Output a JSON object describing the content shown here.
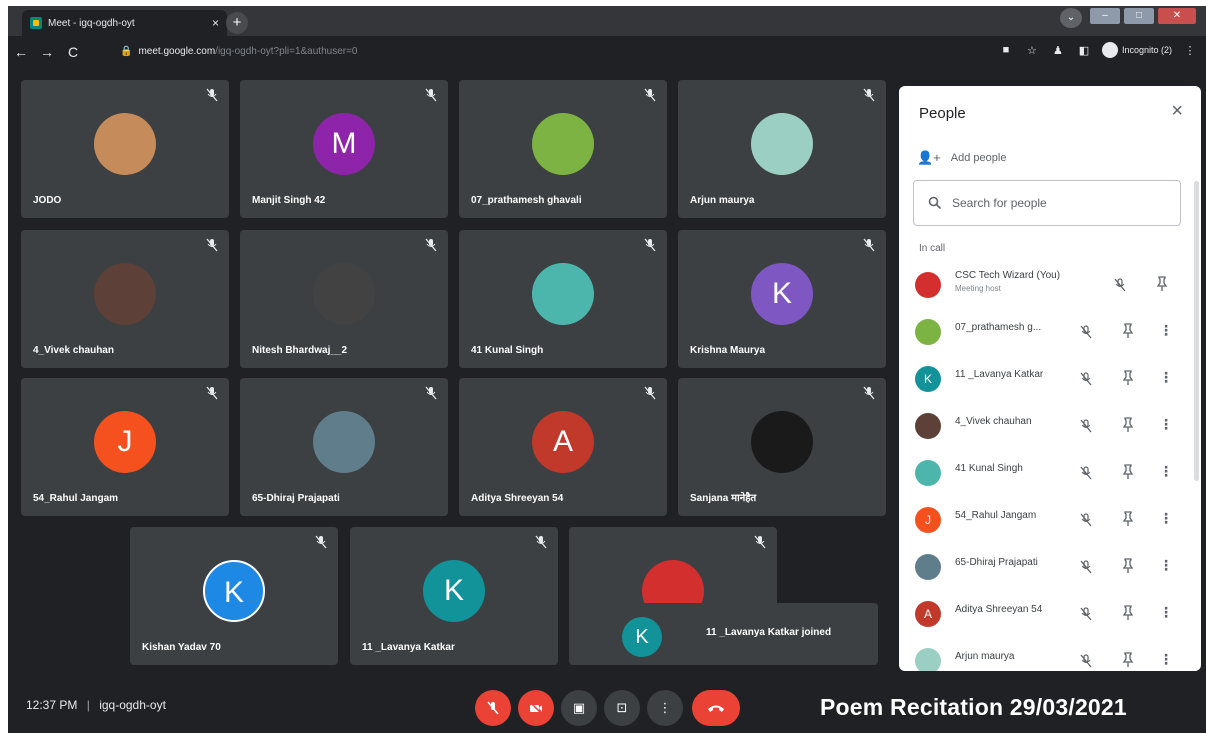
{
  "browser": {
    "tab_title": "Meet - igq-ogdh-oyt",
    "tab_close": "×",
    "new_tab": "+",
    "url_host": "meet.google.com",
    "url_path": "/igq-ogdh-oyt?pli=1&authuser=0",
    "profile_label": "Incognito (2)"
  },
  "tiles": [
    {
      "name": "JODO",
      "avatar_letter": "",
      "avatar_color": "#c58b5a"
    },
    {
      "name": "Manjit Singh 42",
      "avatar_letter": "M",
      "avatar_color": "#8e24aa"
    },
    {
      "name": "07_prathamesh ghavali",
      "avatar_letter": "",
      "avatar_color": "#7cb342"
    },
    {
      "name": "Arjun maurya",
      "avatar_letter": "",
      "avatar_color": "#9ccfc3"
    },
    {
      "name": "4_Vivek chauhan",
      "avatar_letter": "",
      "avatar_color": "#5d4037"
    },
    {
      "name": "Nitesh Bhardwaj__2",
      "avatar_letter": "",
      "avatar_color": "#424242"
    },
    {
      "name": "41 Kunal Singh",
      "avatar_letter": "",
      "avatar_color": "#4db6ac"
    },
    {
      "name": "Krishna Maurya",
      "avatar_letter": "K",
      "avatar_color": "#7e57c2"
    },
    {
      "name": "54_Rahul Jangam",
      "avatar_letter": "J",
      "avatar_color": "#f4511e"
    },
    {
      "name": "65-Dhiraj Prajapati",
      "avatar_letter": "",
      "avatar_color": "#607d8b"
    },
    {
      "name": "Aditya Shreeyan 54",
      "avatar_letter": "A",
      "avatar_color": "#c0392b"
    },
    {
      "name": "Sanjana मानेहैत",
      "avatar_letter": "",
      "avatar_color": "#1a1a1a"
    },
    {
      "name": "Kishan Yadav 70",
      "avatar_letter": "K",
      "avatar_color": "#1e88e5"
    },
    {
      "name": "11 _Lavanya Katkar",
      "avatar_letter": "K",
      "avatar_color": "#12939a"
    },
    {
      "name": "",
      "avatar_letter": "",
      "avatar_color": "#d32f2f"
    }
  ],
  "toast": {
    "avatar_letter": "K",
    "text": "11 _Lavanya Katkar joined"
  },
  "bottom": {
    "time": "12:37 PM",
    "separator": "|",
    "meeting_code": "igq-ogdh-oyt",
    "overlay_caption": "Poem Recitation 29/03/2021"
  },
  "people_panel": {
    "title": "People",
    "close": "×",
    "add_people": "Add people",
    "search_placeholder": "Search for people",
    "in_call": "In call",
    "participants": [
      {
        "name": "CSC Tech Wizard (You)",
        "sub": "Meeting host",
        "letter": "",
        "color": "#d32f2f",
        "host": true
      },
      {
        "name": "07_prathamesh g...",
        "sub": "",
        "letter": "",
        "color": "#7cb342",
        "host": false
      },
      {
        "name": "11 _Lavanya Katkar",
        "sub": "",
        "letter": "K",
        "color": "#12939a",
        "host": false
      },
      {
        "name": "4_Vivek chauhan",
        "sub": "",
        "letter": "",
        "color": "#5d4037",
        "host": false
      },
      {
        "name": "41 Kunal Singh",
        "sub": "",
        "letter": "",
        "color": "#4db6ac",
        "host": false
      },
      {
        "name": "54_Rahul Jangam",
        "sub": "",
        "letter": "J",
        "color": "#f4511e",
        "host": false
      },
      {
        "name": "65-Dhiraj Prajapati",
        "sub": "",
        "letter": "",
        "color": "#607d8b",
        "host": false
      },
      {
        "name": "Aditya Shreeyan 54",
        "sub": "",
        "letter": "A",
        "color": "#c0392b",
        "host": false
      },
      {
        "name": "Arjun maurya",
        "sub": "",
        "letter": "",
        "color": "#9ccfc3",
        "host": false
      }
    ]
  },
  "colors": {
    "meet_bg": "#202124",
    "tile_bg": "#3c4043",
    "end_call": "#ea4335"
  }
}
